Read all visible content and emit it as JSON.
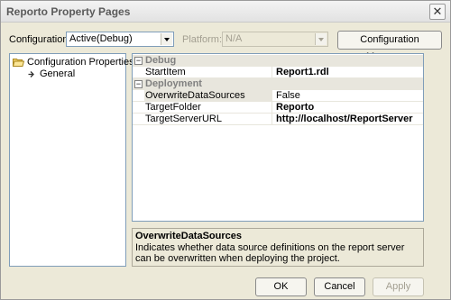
{
  "window": {
    "title": "Reporto Property Pages",
    "close_glyph": "✕"
  },
  "configuration": {
    "label": "Configuration:",
    "value": "Active(Debug)"
  },
  "platform": {
    "label": "Platform:",
    "value": "N/A"
  },
  "config_manager_label": "Configuration Manager...",
  "tree": {
    "root": "Configuration Properties",
    "child": "General"
  },
  "grid": {
    "categories": [
      {
        "name": "Debug",
        "toggle": "⊟",
        "properties": [
          {
            "name": "StartItem",
            "value": "Report1.rdl",
            "bold": true
          }
        ]
      },
      {
        "name": "Deployment",
        "toggle": "⊟",
        "properties": [
          {
            "name": "OverwriteDataSources",
            "value": "False",
            "bold": false
          },
          {
            "name": "TargetFolder",
            "value": "Reporto",
            "bold": true
          },
          {
            "name": "TargetServerURL",
            "value": "http://localhost/ReportServer",
            "bold": true
          }
        ]
      }
    ]
  },
  "description": {
    "title": "OverwriteDataSources",
    "text": "Indicates whether data source definitions on the report server can be overwritten when deploying the project."
  },
  "buttons": {
    "ok": "OK",
    "cancel": "Cancel",
    "apply": "Apply"
  },
  "colors": {
    "title_text": "#5a5a5a",
    "category_bg": "#e8e6dd",
    "dialog_bg": "#ece9d8"
  }
}
